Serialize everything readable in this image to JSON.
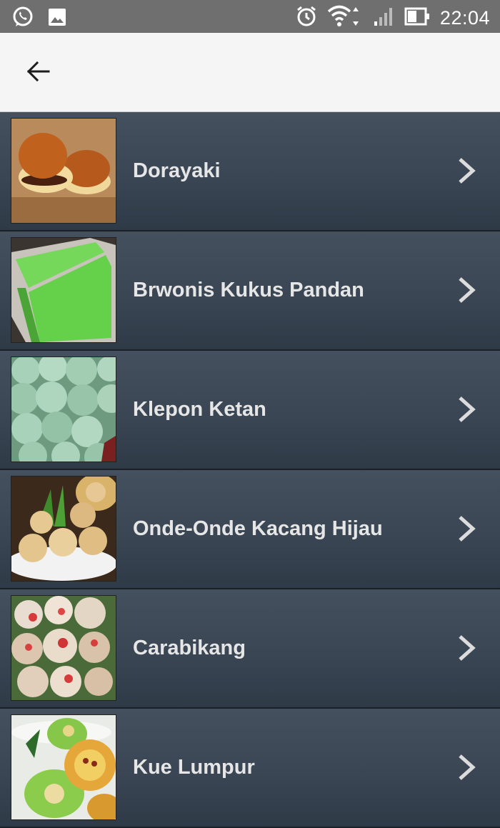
{
  "status_bar": {
    "time": "22:04",
    "icons_left": [
      "whatsapp-icon",
      "gallery-icon"
    ],
    "icons_right": [
      "alarm-icon",
      "wifi-icon",
      "signal-icon",
      "battery-icon"
    ]
  },
  "app_bar": {
    "back_icon": "arrow-back-icon"
  },
  "items": [
    {
      "label": "Dorayaki",
      "thumb": "dorayaki"
    },
    {
      "label": "Brwonis Kukus Pandan",
      "thumb": "pandan-brownies"
    },
    {
      "label": "Klepon Ketan",
      "thumb": "klepon"
    },
    {
      "label": "Onde-Onde Kacang Hijau",
      "thumb": "onde-onde"
    },
    {
      "label": "Carabikang",
      "thumb": "carabikang"
    },
    {
      "label": "Kue Lumpur",
      "thumb": "kue-lumpur"
    }
  ]
}
